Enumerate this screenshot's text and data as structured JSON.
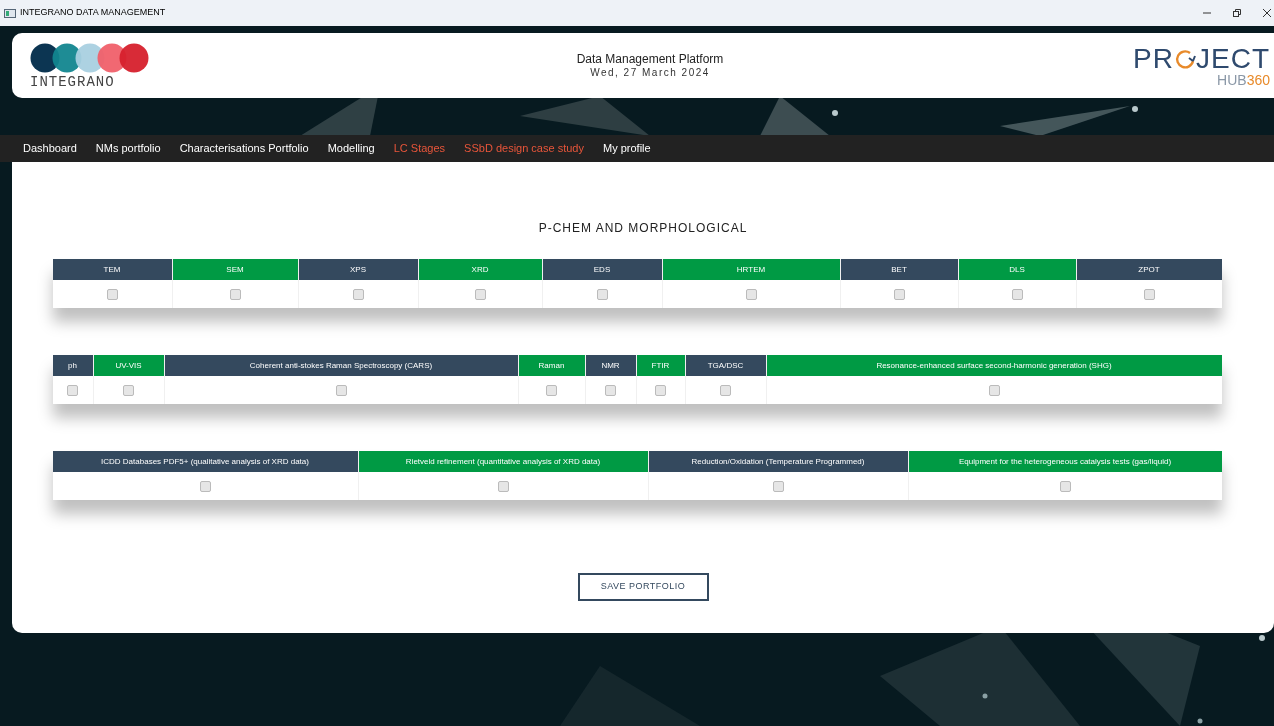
{
  "window": {
    "title": "INTEGRANO DATA MANAGEMENT"
  },
  "header": {
    "logo_text": "INTEGRANO",
    "title": "Data Management Platform",
    "date": "Wed, 27 March 2024",
    "project_logo": {
      "left": "PR",
      "right": "JECT",
      "sub": "HUB",
      "sub_accent": "360"
    }
  },
  "nav": [
    {
      "label": "Dashboard",
      "color": "#ffffff"
    },
    {
      "label": "NMs portfolio",
      "color": "#ffffff"
    },
    {
      "label": "Characterisations Portfolio",
      "color": "#ffffff"
    },
    {
      "label": "Modelling",
      "color": "#ffffff"
    },
    {
      "label": "LC Stages",
      "color": "#e8553a"
    },
    {
      "label": "SSbD design case study",
      "color": "#e8553a"
    },
    {
      "label": "My profile",
      "color": "#ffffff"
    }
  ],
  "section_title": "P-CHEM AND MORPHOLOGICAL",
  "tables": [
    {
      "columns": [
        {
          "label": "TEM",
          "color": "#34495e",
          "checked": false
        },
        {
          "label": "SEM",
          "color": "#009a44",
          "checked": false
        },
        {
          "label": "XPS",
          "color": "#34495e",
          "checked": false
        },
        {
          "label": "XRD",
          "color": "#009a44",
          "checked": false
        },
        {
          "label": "EDS",
          "color": "#34495e",
          "checked": false
        },
        {
          "label": "HRTEM",
          "color": "#009a44",
          "checked": false
        },
        {
          "label": "BET",
          "color": "#34495e",
          "checked": false
        },
        {
          "label": "DLS",
          "color": "#009a44",
          "checked": false
        },
        {
          "label": "ZPOT",
          "color": "#34495e",
          "checked": false
        }
      ]
    },
    {
      "columns": [
        {
          "label": "ph",
          "color": "#34495e",
          "checked": false
        },
        {
          "label": "UV-VIS",
          "color": "#009a44",
          "checked": false
        },
        {
          "label": "Coherent anti-stokes Raman Spectroscopy (CARS)",
          "color": "#34495e",
          "checked": false
        },
        {
          "label": "Raman",
          "color": "#009a44",
          "checked": false
        },
        {
          "label": "NMR",
          "color": "#34495e",
          "checked": false
        },
        {
          "label": "FTIR",
          "color": "#009a44",
          "checked": false
        },
        {
          "label": "TGA/DSC",
          "color": "#34495e",
          "checked": false
        },
        {
          "label": "Resonance-enhanced surface second-harmonic generation (SHG)",
          "color": "#009a44",
          "checked": false
        }
      ]
    },
    {
      "columns": [
        {
          "label": "ICDD Databases PDF5+ (qualitative analysis of XRD data)",
          "color": "#34495e",
          "checked": false
        },
        {
          "label": "Rietveld refinement (quantitative analysis of XRD data)",
          "color": "#009a44",
          "checked": false
        },
        {
          "label": "Reduction/Oxidation (Temperature Programmed)",
          "color": "#34495e",
          "checked": false
        },
        {
          "label": "Equipment for the heterogeneous catalysis tests (gas/liquid)",
          "color": "#009a44",
          "checked": false
        }
      ]
    }
  ],
  "save_button": "SAVE PORTFOLIO"
}
